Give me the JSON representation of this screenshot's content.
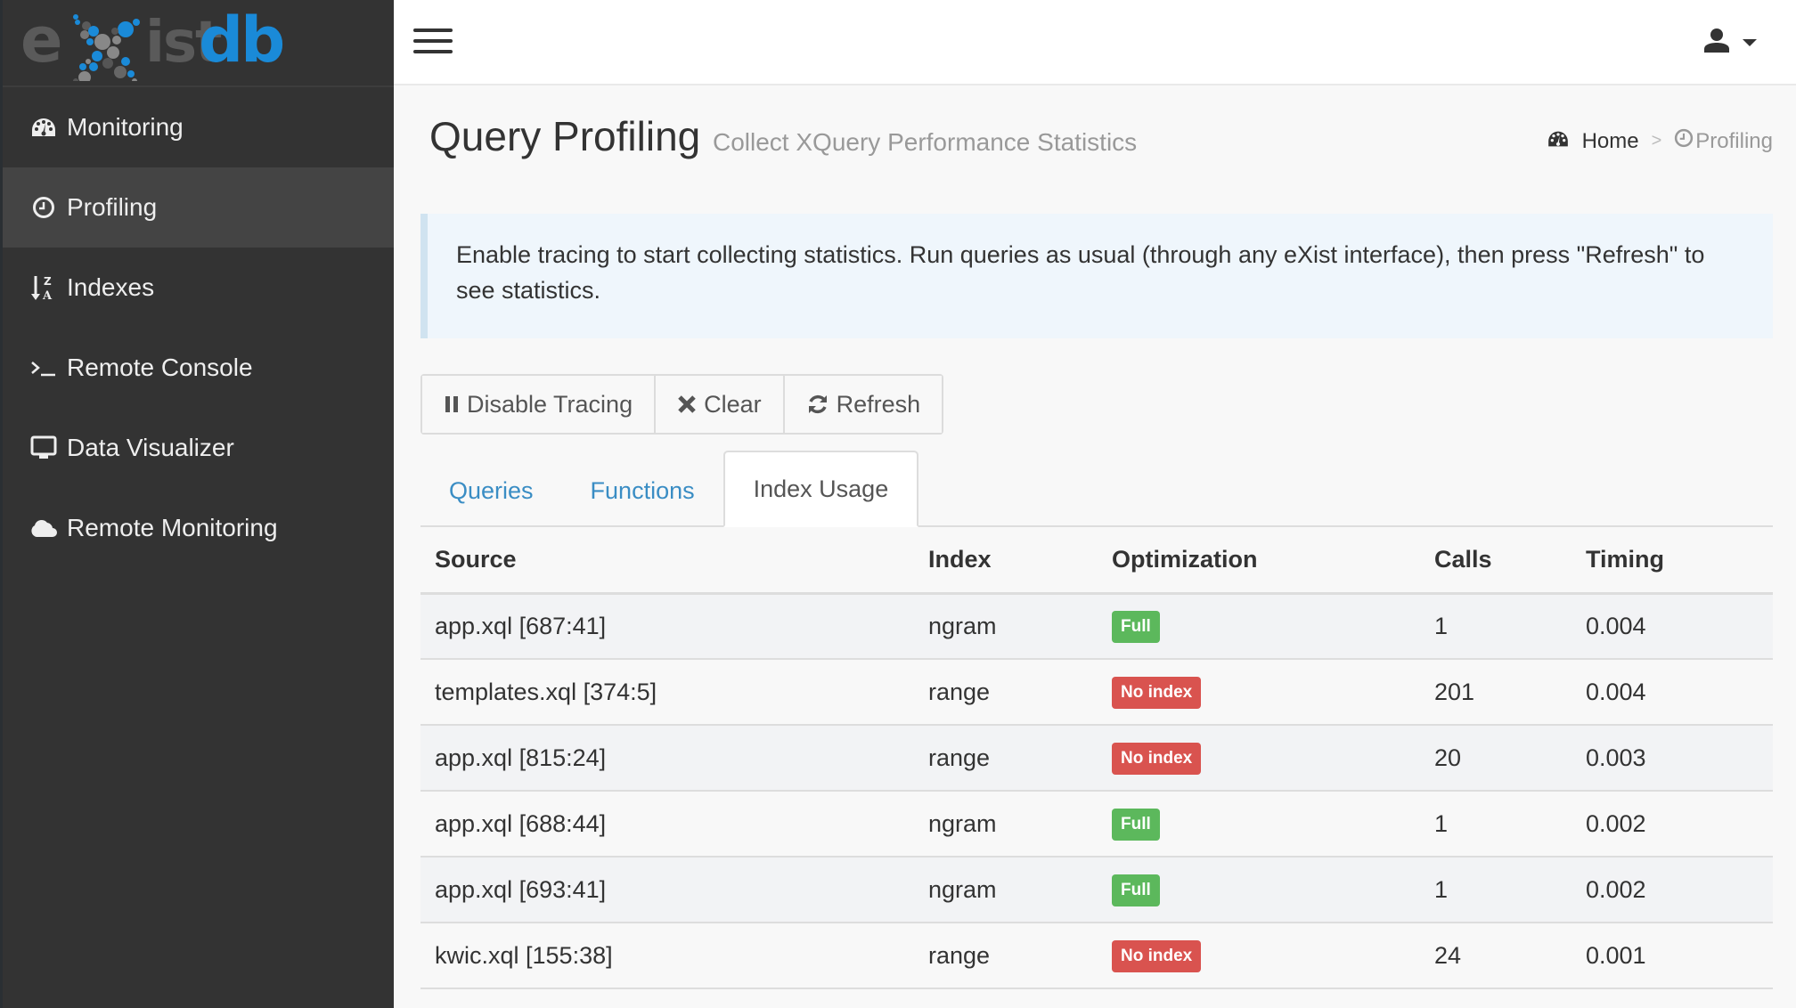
{
  "logo": {
    "text_left": "exist",
    "text_right": "db",
    "accent": "#1a8ad8"
  },
  "sidebar": {
    "items": [
      {
        "label": "Monitoring",
        "icon": "dashboard-icon",
        "active": false
      },
      {
        "label": "Profiling",
        "icon": "clock-icon",
        "active": true
      },
      {
        "label": "Indexes",
        "icon": "sort-alpha-icon",
        "active": false
      },
      {
        "label": "Remote Console",
        "icon": "terminal-icon",
        "active": false
      },
      {
        "label": "Data Visualizer",
        "icon": "desktop-icon",
        "active": false
      },
      {
        "label": "Remote Monitoring",
        "icon": "cloud-icon",
        "active": false
      }
    ]
  },
  "header": {
    "menu_icon": "hamburger-icon",
    "user_icon": "user-icon"
  },
  "page": {
    "title": "Query Profiling",
    "subtitle": "Collect XQuery Performance Statistics",
    "breadcrumb": {
      "home": "Home",
      "separator": ">",
      "current": "Profiling"
    }
  },
  "callout": {
    "text": "Enable tracing to start collecting statistics. Run queries as usual (through any eXist interface), then press \"Refresh\" to see statistics."
  },
  "toolbar": {
    "disable_tracing": "Disable Tracing",
    "clear": "Clear",
    "refresh": "Refresh"
  },
  "tabs": [
    {
      "label": "Queries",
      "active": false
    },
    {
      "label": "Functions",
      "active": false
    },
    {
      "label": "Index Usage",
      "active": true
    }
  ],
  "table": {
    "columns": [
      "Source",
      "Index",
      "Optimization",
      "Calls",
      "Timing"
    ],
    "rows": [
      {
        "source": "app.xql [687:41]",
        "index": "ngram",
        "optimization": "Full",
        "calls": "1",
        "timing": "0.004"
      },
      {
        "source": "templates.xql [374:5]",
        "index": "range",
        "optimization": "No index",
        "calls": "201",
        "timing": "0.004"
      },
      {
        "source": "app.xql [815:24]",
        "index": "range",
        "optimization": "No index",
        "calls": "20",
        "timing": "0.003"
      },
      {
        "source": "app.xql [688:44]",
        "index": "ngram",
        "optimization": "Full",
        "calls": "1",
        "timing": "0.002"
      },
      {
        "source": "app.xql [693:41]",
        "index": "ngram",
        "optimization": "Full",
        "calls": "1",
        "timing": "0.002"
      },
      {
        "source": "kwic.xql [155:38]",
        "index": "range",
        "optimization": "No index",
        "calls": "24",
        "timing": "0.001"
      }
    ]
  },
  "colors": {
    "sidebar_bg": "#333333",
    "sidebar_active": "#444444",
    "link": "#3a8dc4",
    "badge_full": "#5cb85c",
    "badge_no_index": "#d9534f",
    "callout_bg": "#eff6fc",
    "callout_border": "#d0e3f0"
  }
}
